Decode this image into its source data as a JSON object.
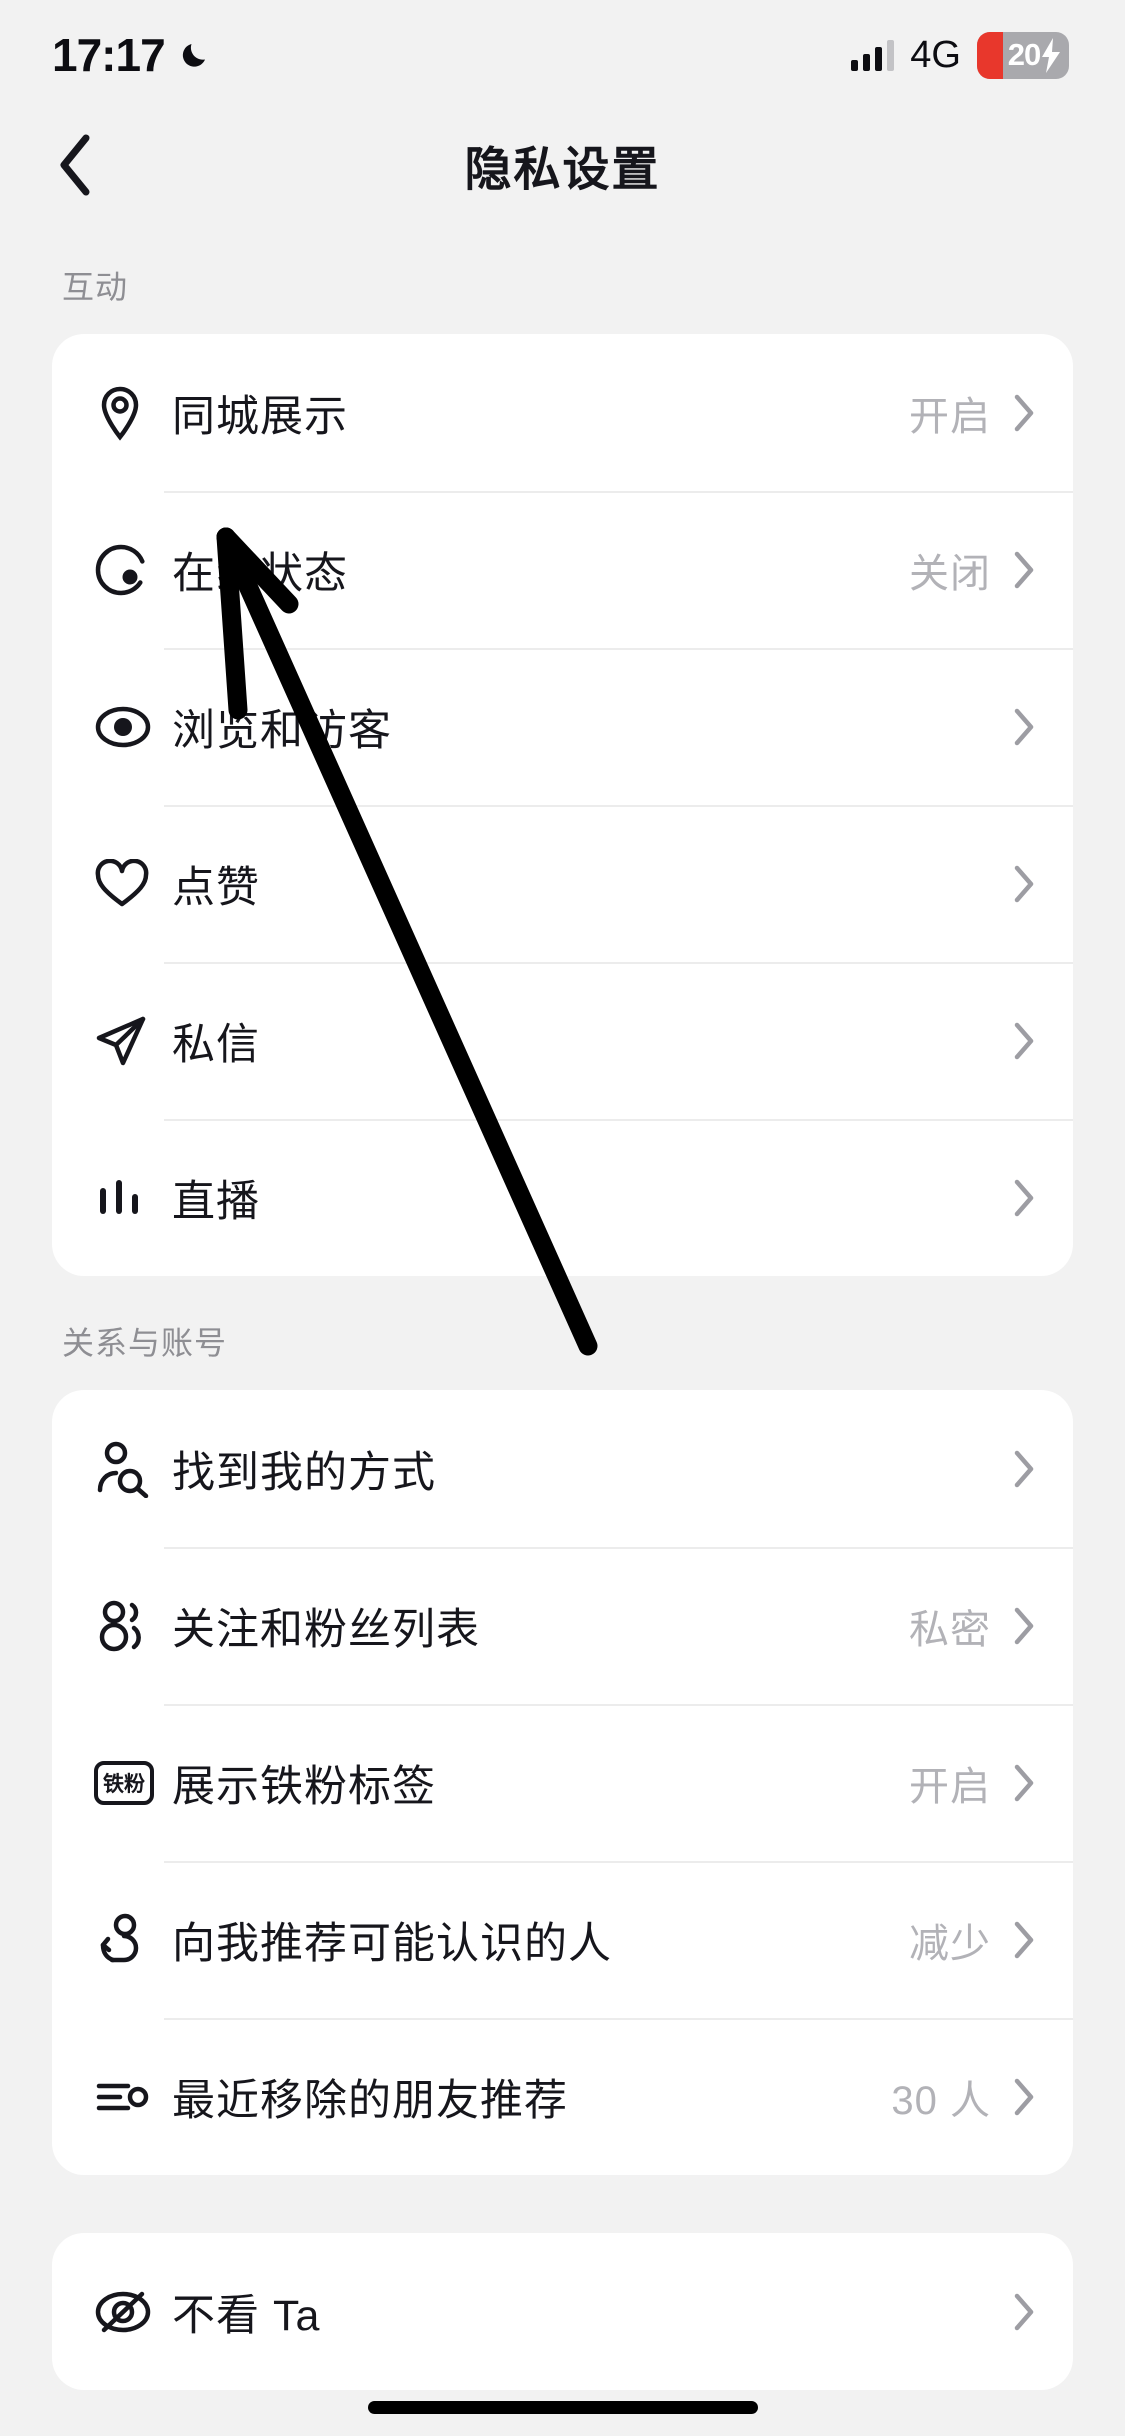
{
  "status_bar": {
    "time": "17:17",
    "moon_icon": "crescent-moon-icon",
    "signal_icon": "signal-bars-icon",
    "network": "4G",
    "battery_percent": "20",
    "battery_charging_icon": "lightning-bolt-icon",
    "battery_fill_color": "#e8372c",
    "battery_body_color": "#a9a9ad"
  },
  "nav": {
    "back_icon": "back-chevron-icon",
    "title": "隐私设置"
  },
  "sections": [
    {
      "title": "互动",
      "rows": [
        {
          "icon": "location-pin-icon",
          "label": "同城展示",
          "value": "开启"
        },
        {
          "icon": "online-status-icon",
          "label": "在线状态",
          "value": "关闭"
        },
        {
          "icon": "eye-icon",
          "label": "浏览和访客",
          "value": ""
        },
        {
          "icon": "heart-icon",
          "label": "点赞",
          "value": ""
        },
        {
          "icon": "paper-plane-icon",
          "label": "私信",
          "value": ""
        },
        {
          "icon": "live-bars-icon",
          "label": "直播",
          "value": ""
        }
      ]
    },
    {
      "title": "关系与账号",
      "rows": [
        {
          "icon": "person-search-icon",
          "label": "找到我的方式",
          "value": ""
        },
        {
          "icon": "two-people-icon",
          "label": "关注和粉丝列表",
          "value": "私密"
        },
        {
          "icon": "fan-badge-icon",
          "label": "展示铁粉标签",
          "value": "开启",
          "badge_text": "铁粉"
        },
        {
          "icon": "person-suggest-icon",
          "label": "向我推荐可能认识的人",
          "value": "减少"
        },
        {
          "icon": "list-remove-icon",
          "label": "最近移除的朋友推荐",
          "value": "30 人"
        }
      ]
    },
    {
      "title": "",
      "rows": [
        {
          "icon": "eye-off-icon",
          "label": "不看 Ta",
          "value": ""
        }
      ]
    }
  ],
  "annotation": {
    "arrow_icon": "pointer-arrow-annotation",
    "color": "#000000",
    "points_to": "浏览和访客"
  },
  "colors": {
    "background": "#f2f2f2",
    "card": "#ffffff",
    "primary_text": "#16161c",
    "secondary_text": "#b2b2b7",
    "section_title": "#8e8e93",
    "divider": "#ececec"
  }
}
